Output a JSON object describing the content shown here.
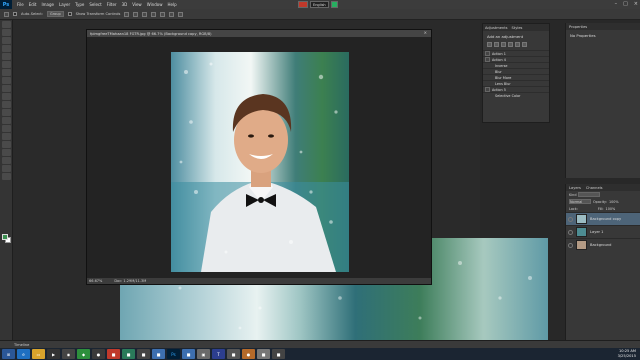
{
  "app": {
    "logo": "Ps"
  },
  "menu": [
    "File",
    "Edit",
    "Image",
    "Layer",
    "Type",
    "Select",
    "Filter",
    "3D",
    "View",
    "Window",
    "Help"
  ],
  "ime": {
    "language": "English"
  },
  "options": {
    "auto_select_label": "Auto-Select:",
    "auto_select_value": "Group",
    "transform_label": "Show Transform Controls"
  },
  "document": {
    "tab_title": "fpimgfreeTMahaan18 FGTR.jpg @ 66.7% (Background copy, RGB/8)",
    "zoom": "66.67%",
    "doc_size": "Doc: 1.29M/11.3M"
  },
  "adjustments": {
    "tabs": [
      "Adjustments",
      "Styles"
    ],
    "title": "Add an adjustment",
    "items": [
      {
        "label": "Action 1"
      },
      {
        "label": "Action 4"
      },
      {
        "label": "Inverse"
      },
      {
        "label": "Blur"
      },
      {
        "label": "Blur More"
      },
      {
        "label": "Lens Blur"
      },
      {
        "label": "Action 5"
      },
      {
        "label": "Selective Color"
      }
    ]
  },
  "properties": {
    "title": "Properties",
    "empty": "No Properties"
  },
  "layers": {
    "tabs": [
      "Layers",
      "Channels"
    ],
    "kind_label": "Kind",
    "blend_mode": "Normal",
    "opacity_label": "Opacity:",
    "opacity": "100%",
    "lock_label": "Lock:",
    "fill_label": "Fill:",
    "fill": "100%",
    "items": [
      {
        "name": "Background copy",
        "selected": true
      },
      {
        "name": "Layer 1",
        "selected": false
      },
      {
        "name": "Background",
        "selected": false
      }
    ]
  },
  "timeline": {
    "label": "Timeline"
  },
  "tray": {
    "time": "10:25 AM",
    "date": "3/25/2015"
  },
  "colors": {
    "accent": "#31a8ff",
    "selection": "#4d6478",
    "fg_swatch": "#3a8f4f",
    "bg_swatch": "#ffffff"
  }
}
